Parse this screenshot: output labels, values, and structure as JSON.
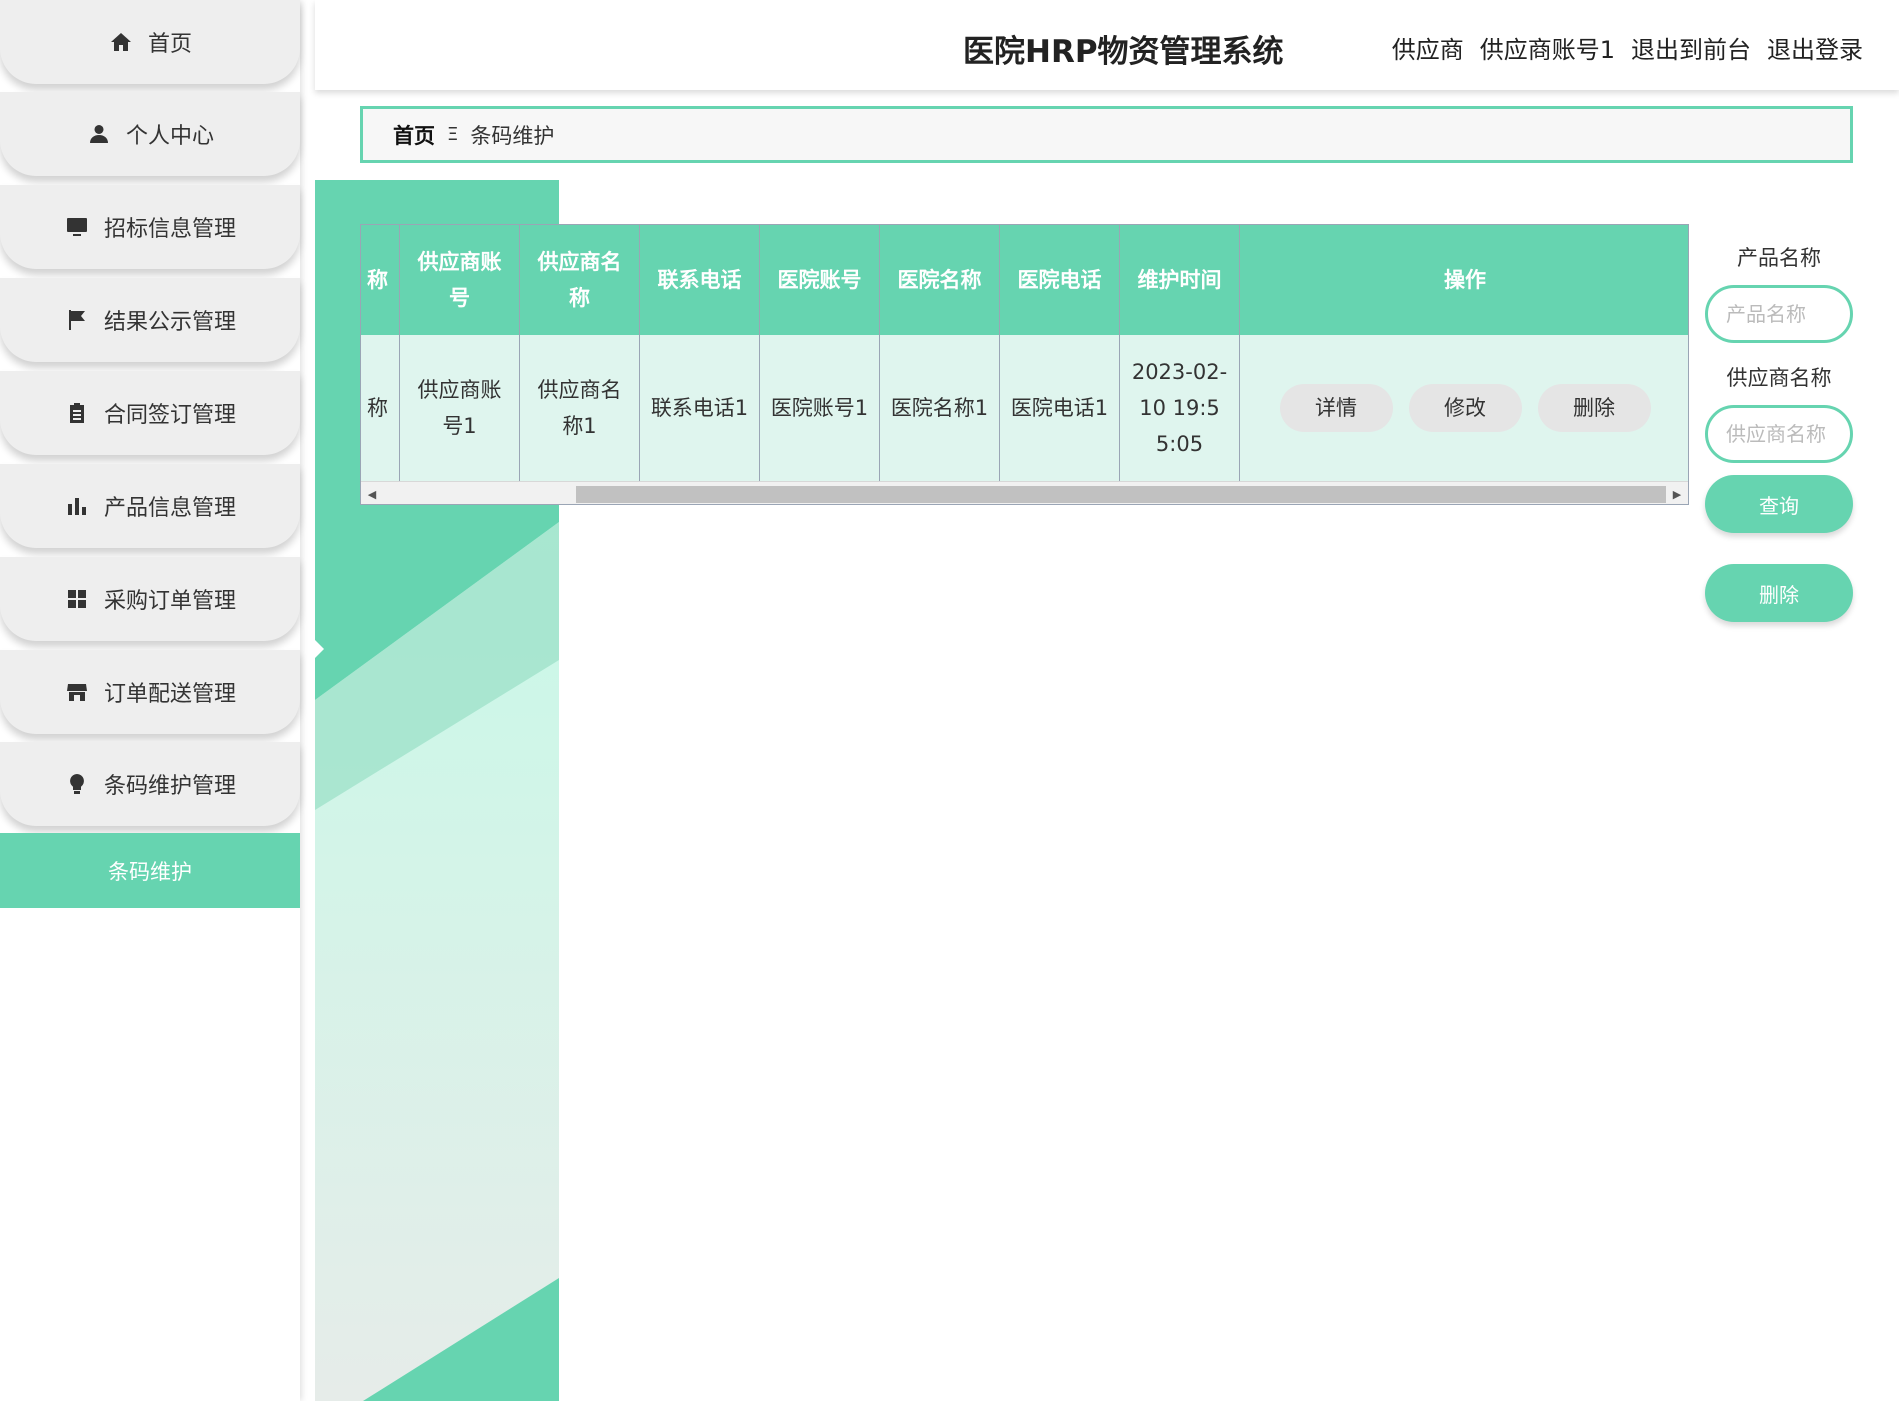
{
  "app": {
    "title": "医院HRP物资管理系统"
  },
  "user": {
    "role": "供应商",
    "account": "供应商账号1",
    "front_link": "退出到前台",
    "logout_link": "退出登录"
  },
  "sidebar": {
    "items": [
      {
        "label": "首页",
        "icon": "home-icon"
      },
      {
        "label": "个人中心",
        "icon": "user-icon"
      },
      {
        "label": "招标信息管理",
        "icon": "monitor-icon"
      },
      {
        "label": "结果公示管理",
        "icon": "flag-icon"
      },
      {
        "label": "合同签订管理",
        "icon": "clipboard-icon"
      },
      {
        "label": "产品信息管理",
        "icon": "bar-chart-icon"
      },
      {
        "label": "采购订单管理",
        "icon": "grid-icon"
      },
      {
        "label": "订单配送管理",
        "icon": "store-icon"
      },
      {
        "label": "条码维护管理",
        "icon": "bulb-icon"
      }
    ],
    "sub_item": "条码维护"
  },
  "breadcrumb": {
    "home": "首页",
    "separator": "Ξ",
    "current": "条码维护"
  },
  "table": {
    "headers": [
      "称",
      "供应商账号",
      "供应商名称",
      "联系电话",
      "医院账号",
      "医院名称",
      "医院电话",
      "维护时间",
      "操作"
    ],
    "rows": [
      {
        "cells": [
          "称",
          "供应商账号1",
          "供应商名称1",
          "联系电话1",
          "医院账号1",
          "医院名称1",
          "医院电话1",
          "2023-02-10 19:55:05"
        ],
        "actions": [
          "详情",
          "修改",
          "删除"
        ]
      }
    ]
  },
  "search": {
    "product_label": "产品名称",
    "product_placeholder": "产品名称",
    "product_value": "",
    "supplier_label": "供应商名称",
    "supplier_placeholder": "供应商名称",
    "supplier_value": "",
    "query_button": "查询",
    "delete_button": "删除"
  },
  "colors": {
    "accent": "#66d4b0",
    "accent_light": "#dff5ee",
    "menu_bg": "#eeeeee"
  }
}
